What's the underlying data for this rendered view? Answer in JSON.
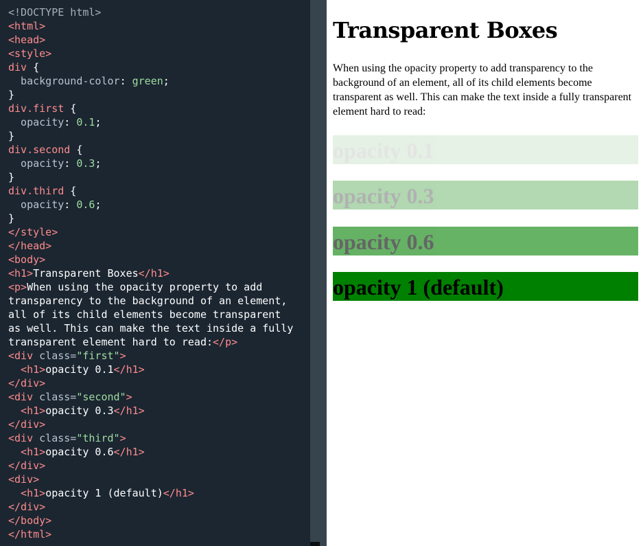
{
  "editor": {
    "colors": {
      "background": "#1b2631",
      "default": "#ffffff",
      "doctype": "#a6b0ba",
      "tag": "#ff8c8c",
      "attr": "#b7c3cf",
      "string": "#a0dca0",
      "number": "#a0dca0",
      "text": "#ffffff"
    },
    "lines": [
      [
        {
          "t": "<!DOCTYPE html>",
          "c": "doctype"
        }
      ],
      [
        {
          "t": "<html>",
          "c": "tag"
        }
      ],
      [
        {
          "t": "<head>",
          "c": "tag"
        }
      ],
      [
        {
          "t": "<style>",
          "c": "tag"
        }
      ],
      [
        {
          "t": "div",
          "c": "tag"
        },
        {
          "t": " {",
          "c": "default"
        }
      ],
      [
        {
          "t": "  background-color",
          "c": "attr"
        },
        {
          "t": ": ",
          "c": "default"
        },
        {
          "t": "green",
          "c": "string"
        },
        {
          "t": ";",
          "c": "default"
        }
      ],
      [
        {
          "t": "}",
          "c": "default"
        }
      ],
      [
        {
          "t": "div.first",
          "c": "tag"
        },
        {
          "t": " {",
          "c": "default"
        }
      ],
      [
        {
          "t": "  opacity",
          "c": "attr"
        },
        {
          "t": ": ",
          "c": "default"
        },
        {
          "t": "0.1",
          "c": "number"
        },
        {
          "t": ";",
          "c": "default"
        }
      ],
      [
        {
          "t": "}",
          "c": "default"
        }
      ],
      [
        {
          "t": "div.second",
          "c": "tag"
        },
        {
          "t": " {",
          "c": "default"
        }
      ],
      [
        {
          "t": "  opacity",
          "c": "attr"
        },
        {
          "t": ": ",
          "c": "default"
        },
        {
          "t": "0.3",
          "c": "number"
        },
        {
          "t": ";",
          "c": "default"
        }
      ],
      [
        {
          "t": "}",
          "c": "default"
        }
      ],
      [
        {
          "t": "div.third",
          "c": "tag"
        },
        {
          "t": " {",
          "c": "default"
        }
      ],
      [
        {
          "t": "  opacity",
          "c": "attr"
        },
        {
          "t": ": ",
          "c": "default"
        },
        {
          "t": "0.6",
          "c": "number"
        },
        {
          "t": ";",
          "c": "default"
        }
      ],
      [
        {
          "t": "}",
          "c": "default"
        }
      ],
      [
        {
          "t": "</style>",
          "c": "tag"
        }
      ],
      [
        {
          "t": "</head>",
          "c": "tag"
        }
      ],
      [
        {
          "t": "<body>",
          "c": "tag"
        }
      ],
      [
        {
          "t": "<h1>",
          "c": "tag"
        },
        {
          "t": "Transparent Boxes",
          "c": "text"
        },
        {
          "t": "</h1>",
          "c": "tag"
        }
      ],
      [
        {
          "t": "<p>",
          "c": "tag"
        },
        {
          "t": "When using the opacity property to add",
          "c": "text"
        }
      ],
      [
        {
          "t": "transparency to the background of an element,",
          "c": "text"
        }
      ],
      [
        {
          "t": "all of its child elements become transparent",
          "c": "text"
        }
      ],
      [
        {
          "t": "as well. This can make the text inside a fully",
          "c": "text"
        }
      ],
      [
        {
          "t": "transparent element hard to read:",
          "c": "text"
        },
        {
          "t": "</p>",
          "c": "tag"
        }
      ],
      [
        {
          "t": "<div ",
          "c": "tag"
        },
        {
          "t": "class=",
          "c": "attr"
        },
        {
          "t": "\"first\"",
          "c": "string"
        },
        {
          "t": ">",
          "c": "tag"
        }
      ],
      [
        {
          "t": "  <h1>",
          "c": "tag"
        },
        {
          "t": "opacity 0.1",
          "c": "text"
        },
        {
          "t": "</h1>",
          "c": "tag"
        }
      ],
      [
        {
          "t": "</div>",
          "c": "tag"
        }
      ],
      [
        {
          "t": "<div ",
          "c": "tag"
        },
        {
          "t": "class=",
          "c": "attr"
        },
        {
          "t": "\"second\"",
          "c": "string"
        },
        {
          "t": ">",
          "c": "tag"
        }
      ],
      [
        {
          "t": "  <h1>",
          "c": "tag"
        },
        {
          "t": "opacity 0.3",
          "c": "text"
        },
        {
          "t": "</h1>",
          "c": "tag"
        }
      ],
      [
        {
          "t": "</div>",
          "c": "tag"
        }
      ],
      [
        {
          "t": "<div ",
          "c": "tag"
        },
        {
          "t": "class=",
          "c": "attr"
        },
        {
          "t": "\"third\"",
          "c": "string"
        },
        {
          "t": ">",
          "c": "tag"
        }
      ],
      [
        {
          "t": "  <h1>",
          "c": "tag"
        },
        {
          "t": "opacity 0.6",
          "c": "text"
        },
        {
          "t": "</h1>",
          "c": "tag"
        }
      ],
      [
        {
          "t": "</div>",
          "c": "tag"
        }
      ],
      [
        {
          "t": "<div>",
          "c": "tag"
        }
      ],
      [
        {
          "t": "  <h1>",
          "c": "tag"
        },
        {
          "t": "opacity 1 (default)",
          "c": "text"
        },
        {
          "t": "</h1>",
          "c": "tag"
        }
      ],
      [
        {
          "t": "</div>",
          "c": "tag"
        }
      ],
      [
        {
          "t": "</body>",
          "c": "tag"
        }
      ],
      [
        {
          "t": "</html>",
          "c": "tag"
        }
      ]
    ]
  },
  "preview": {
    "title": "Transparent Boxes",
    "paragraph": "When using the opacity property to add transparency to the background of an element, all of its child elements become transparent as well. This can make the text inside a fully transparent element hard to read:",
    "box_color": "#008000",
    "boxes": [
      {
        "label": "opacity 0.1",
        "opacity": 0.1
      },
      {
        "label": "opacity 0.3",
        "opacity": 0.3
      },
      {
        "label": "opacity 0.6",
        "opacity": 0.6
      },
      {
        "label": "opacity 1 (default)",
        "opacity": 1
      }
    ]
  }
}
